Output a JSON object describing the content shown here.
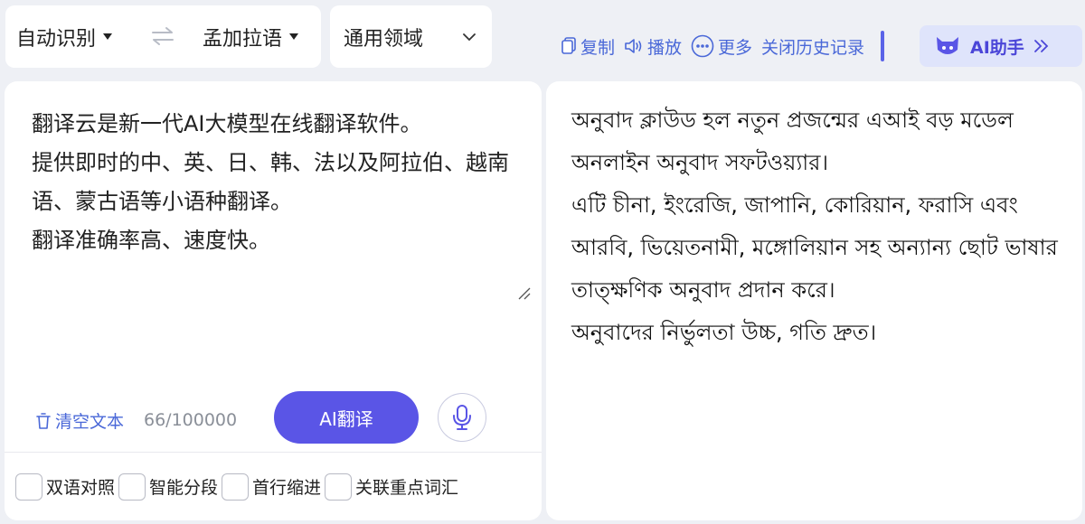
{
  "lang_bar": {
    "source_lang": "自动识别",
    "target_lang": "孟加拉语"
  },
  "domain": {
    "label": "通用领域"
  },
  "toolbar": {
    "copy": "复制",
    "play": "播放",
    "more": "更多",
    "close_history": "关闭历史记录",
    "ai_assistant": "AI助手"
  },
  "source": {
    "text": "翻译云是新一代AI大模型在线翻译软件。\n提供即时的中、英、日、韩、法以及阿拉伯、越南语、蒙古语等小语种翻译。\n翻译准确率高、速度快。",
    "clear_label": "清空文本",
    "char_count": "66/100000",
    "translate_label": "AI翻译"
  },
  "options": [
    {
      "label": "双语对照"
    },
    {
      "label": "智能分段"
    },
    {
      "label": "首行缩进"
    },
    {
      "label": "关联重点词汇"
    }
  ],
  "target": {
    "text": "অনুবাদ ক্লাউড হল নতুন প্রজন্মের এআই বড় মডেল অনলাইন অনুবাদ সফটওয়্যার।\nএটি চীনা, ইংরেজি, জাপানি, কোরিয়ান, ফরাসি এবং আরবি, ভিয়েতনামী, মঙ্গোলিয়ান সহ অন্যান্য ছোট ভাষার তাত্ক্ষণিক অনুবাদ প্রদান করে।\nঅনুবাদের নির্ভুলতা উচ্চ, গতি দ্রুত।"
  },
  "colors": {
    "accent": "#5a55e6",
    "link": "#4a68d8",
    "background": "#eef0f5"
  }
}
